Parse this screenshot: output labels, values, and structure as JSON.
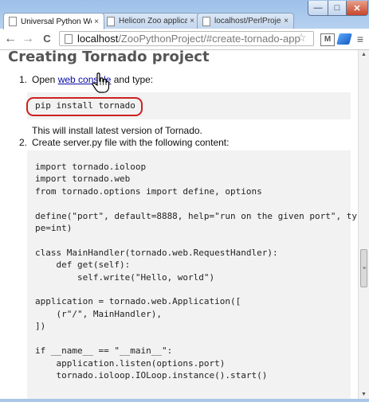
{
  "window": {
    "min_glyph": "—",
    "max_glyph": "□",
    "close_glyph": "✕"
  },
  "tabs": [
    {
      "label": "Universal Python We",
      "close": "×",
      "active": true
    },
    {
      "label": "Helicon Zoo applicat",
      "close": "×",
      "active": false
    },
    {
      "label": "localhost/PerlProject",
      "close": "×",
      "active": false
    }
  ],
  "toolbar": {
    "back_glyph": "←",
    "forward_glyph": "→",
    "reload_glyph": "C",
    "url_host": "localhost",
    "url_path": "/ZooPythonProject/#create-tornado-app",
    "star_glyph": "☆",
    "gmail_glyph": "M",
    "menu_glyph": "≡"
  },
  "content": {
    "heading": "Creating Tornado project",
    "step1_num": "1.",
    "step1_prefix": "Open ",
    "step1_link": "web console",
    "step1_suffix": " and type:",
    "step1_code": "pip install tornado",
    "step1_note": "This will install latest version of Tornado.",
    "step2_num": "2.",
    "step2_text": "Create server.py file with the following content:",
    "step2_code": "import tornado.ioloop\nimport tornado.web\nfrom tornado.options import define, options\n\ndefine(\"port\", default=8888, help=\"run on the given port\", ty\npe=int)\n\nclass MainHandler(tornado.web.RequestHandler):\n    def get(self):\n        self.write(\"Hello, world\")\n\napplication = tornado.web.Application([\n    (r\"/\", MainHandler),\n])\n\nif __name__ == \"__main__\":\n    application.listen(options.port)\n    tornado.ioloop.IOLoop.instance().start()"
  },
  "scrollbar": {
    "up_glyph": "▲",
    "down_glyph": "▼",
    "grip_glyph": "≡"
  },
  "colors": {
    "link": "#0a0aa8",
    "highlight_ring": "#cc2222",
    "code_bg": "#f2f2f2"
  }
}
